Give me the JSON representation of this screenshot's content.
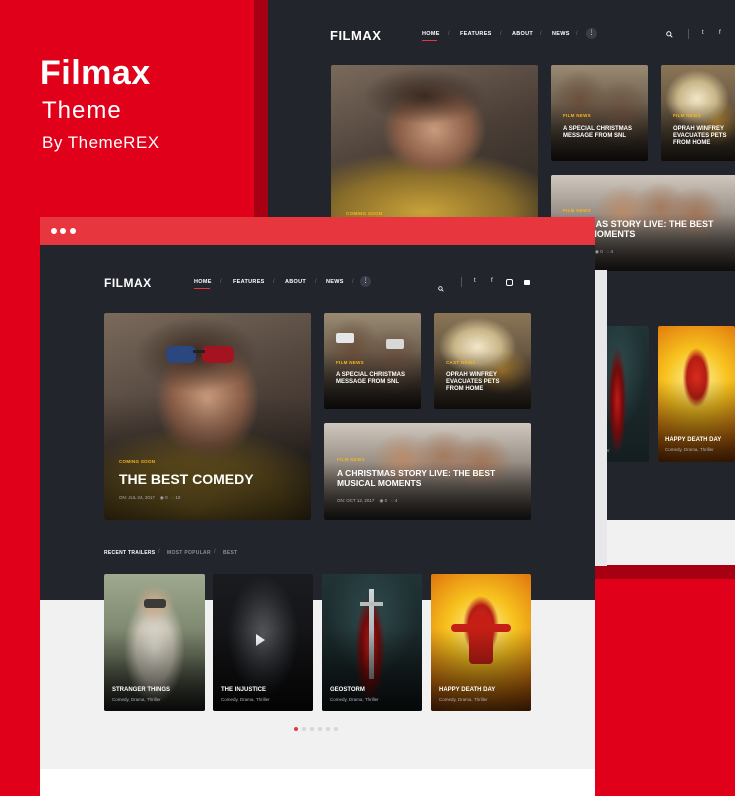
{
  "brand": {
    "name": "Filmax",
    "subtitle": "Theme",
    "author": "By ThemeREX"
  },
  "site": {
    "logo": "FILMAX",
    "nav": [
      "HOME",
      "FEATURES",
      "ABOUT",
      "NEWS"
    ],
    "nav_sep": "/",
    "more": "⋮"
  },
  "posts": {
    "feature": {
      "category": "COMING SOON",
      "title": "THE BEST COMEDY",
      "date": "ON: JUL 24, 2017",
      "views": "0",
      "comments": "10"
    },
    "vr": {
      "category": "FILM NEWS",
      "title": "A SPECIAL CHRISTMAS MESSAGE FROM SNL"
    },
    "oprah": {
      "category": "CAST NEWS",
      "title": "OPRAH WINFREY EVACUATES PETS FROM HOME"
    },
    "xmas": {
      "category": "FILM NEWS",
      "title": "A CHRISTMAS STORY LIVE: THE BEST MUSICAL MOMENTS",
      "date": "ON: OCT 12, 2017",
      "views": "0",
      "comments": "4"
    }
  },
  "back": {
    "vr_category": "FILM NEWS",
    "vr_title": "A SPECIAL CHRISTMAS MESSAGE FROM SNL",
    "oprah_category": "FILM NEWS",
    "oprah_title": "OPRAH WINFREY EVACUATES PETS FROM HOME",
    "xmas_category": "FILM NEWS",
    "xmas_title": "A CHRISTMAS STORY LIVE: THE BEST MUSICAL MOMENTS",
    "feature_category": "COMING SOON",
    "partial_meta": "Thriller",
    "views": "0",
    "comments": "4"
  },
  "trailers": {
    "tabs": [
      "RECENT TRAILERS",
      "MOST POPULAR",
      "BEST"
    ],
    "items": [
      {
        "title": "STRANGER THINGS",
        "genres": "Comedy, Drama, Thriller"
      },
      {
        "title": "THE INJUSTICE",
        "genres": "Comedy, Drama, Thriller"
      },
      {
        "title": "GEOSTORM",
        "genres": "Comedy, Drama, Thriller"
      },
      {
        "title": "HAPPY DEATH DAY",
        "genres": "Comedy, Drama, Thriller"
      }
    ],
    "pagination": {
      "count": 6,
      "active": 0
    }
  },
  "icons": [
    "search-icon",
    "twitter-icon",
    "facebook-icon",
    "instagram-icon",
    "youtube-icon",
    "play-icon",
    "eye-icon",
    "comment-icon"
  ],
  "colors": {
    "brand_red": "#e0001a",
    "dark_bg": "#23252d",
    "accent_yellow": "#f6b61d",
    "window_bar": "#e8363f"
  }
}
